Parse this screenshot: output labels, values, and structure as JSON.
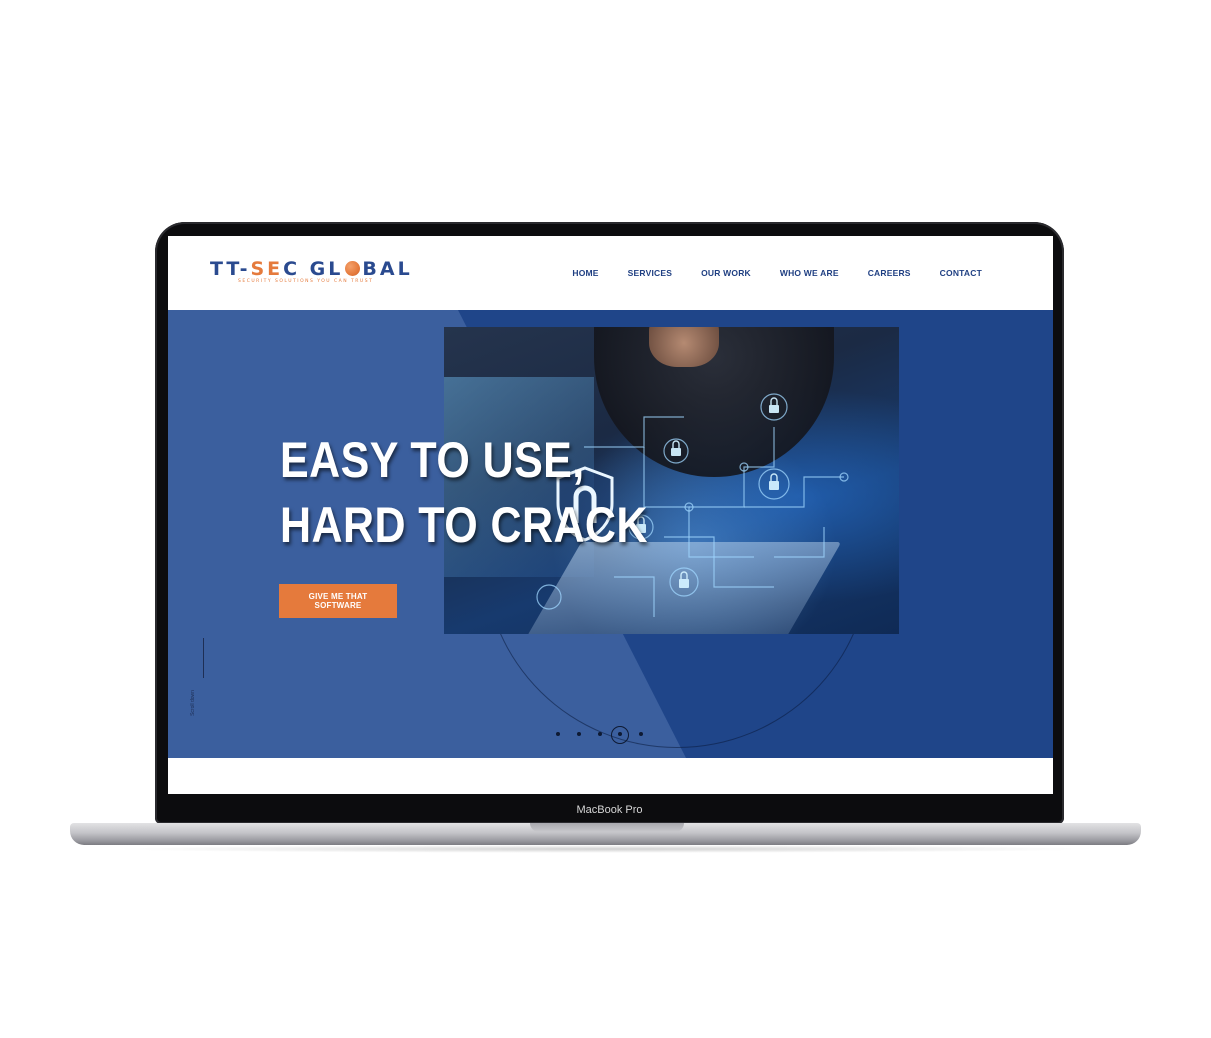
{
  "device": {
    "label": "MacBook Pro"
  },
  "header": {
    "logo": {
      "part1": "TT-",
      "part2": "S",
      "part3": "E",
      "part4": "C GL",
      "part5": "BAL",
      "tagline": "SECURITY SOLUTIONS YOU CAN TRUST"
    },
    "nav": [
      "HOME",
      "SERVICES",
      "OUR WORK",
      "WHO WE ARE",
      "CAREERS",
      "CONTACT"
    ]
  },
  "hero": {
    "title_line1": "EASY TO USE,",
    "title_line2": "HARD TO CRACK",
    "cta_label": "GIVE ME THAT SOFTWARE",
    "scroll_label": "Scroll down",
    "slider": {
      "count": 5,
      "active_index": 3
    }
  },
  "colors": {
    "brand_blue": "#2a4a8f",
    "accent_orange": "#e57a3c",
    "hero_blue": "#3b5f9e",
    "hero_dark_blue": "#1f4589"
  }
}
